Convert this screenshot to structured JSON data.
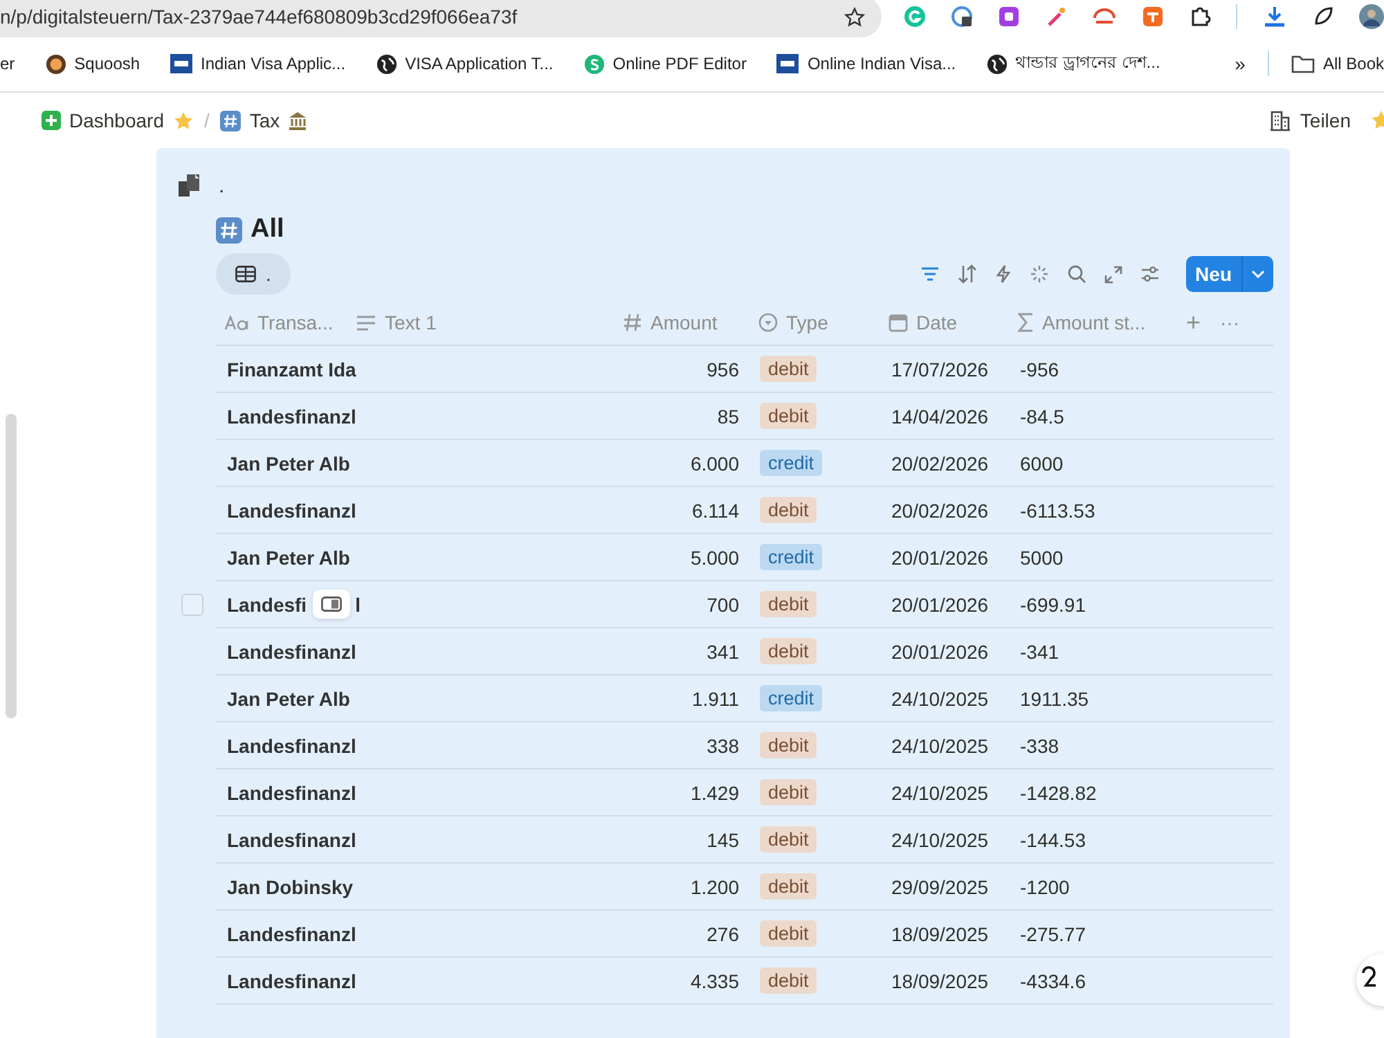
{
  "browser": {
    "url": "n/p/digitalsteuern/Tax-2379ae744ef680809b3cd29f066ea73f",
    "bookmarks": [
      "er",
      "Squoosh",
      "Indian Visa Applic...",
      "VISA Application T...",
      "Online PDF Editor",
      "Online Indian Visa...",
      "থান্ডার ড্রাগনের দেশ..."
    ],
    "more": "»",
    "all_bookmarks": "All Book"
  },
  "breadcrumbs": [
    "Dashboard",
    "Tax"
  ],
  "separator": "/",
  "share": "Teilen",
  "page": {
    "title": ".",
    "view_title": "All",
    "view_tab": ".",
    "new_button": "Neu",
    "columns": [
      "Transa...",
      "Text 1",
      "Amount",
      "Type",
      "Date",
      "Amount st..."
    ],
    "add_column": "+",
    "more": "···",
    "rows": [
      {
        "title": "Finanzamt Ida",
        "amount": "956",
        "type": "debit",
        "date": "17/07/2026",
        "amount_st": "-956",
        "hovered": false
      },
      {
        "title": "Landesfinanzl",
        "amount": "85",
        "type": "debit",
        "date": "14/04/2026",
        "amount_st": "-84.5",
        "hovered": false
      },
      {
        "title": "Jan Peter Alb",
        "amount": "6.000",
        "type": "credit",
        "date": "20/02/2026",
        "amount_st": "6000",
        "hovered": false
      },
      {
        "title": "Landesfinanzl",
        "amount": "6.114",
        "type": "debit",
        "date": "20/02/2026",
        "amount_st": "-6113.53",
        "hovered": false
      },
      {
        "title": "Jan Peter Alb",
        "amount": "5.000",
        "type": "credit",
        "date": "20/01/2026",
        "amount_st": "5000",
        "hovered": false
      },
      {
        "title": "Landesfi",
        "title_end": "l",
        "amount": "700",
        "type": "debit",
        "date": "20/01/2026",
        "amount_st": "-699.91",
        "hovered": true,
        "checked": false
      },
      {
        "title": "Landesfinanzl",
        "amount": "341",
        "type": "debit",
        "date": "20/01/2026",
        "amount_st": "-341",
        "hovered": false
      },
      {
        "title": "Jan Peter Alb",
        "amount": "1.911",
        "type": "credit",
        "date": "24/10/2025",
        "amount_st": "1911.35",
        "hovered": false
      },
      {
        "title": "Landesfinanzl",
        "amount": "338",
        "type": "debit",
        "date": "24/10/2025",
        "amount_st": "-338",
        "hovered": false
      },
      {
        "title": "Landesfinanzl",
        "amount": "1.429",
        "type": "debit",
        "date": "24/10/2025",
        "amount_st": "-1428.82",
        "hovered": false
      },
      {
        "title": "Landesfinanzl",
        "amount": "145",
        "type": "debit",
        "date": "24/10/2025",
        "amount_st": "-144.53",
        "hovered": false
      },
      {
        "title": "Jan Dobinsky",
        "amount": "1.200",
        "type": "debit",
        "date": "29/09/2025",
        "amount_st": "-1200",
        "hovered": false
      },
      {
        "title": "Landesfinanzl",
        "amount": "276",
        "type": "debit",
        "date": "18/09/2025",
        "amount_st": "-275.77",
        "hovered": false
      },
      {
        "title": "Landesfinanzl",
        "amount": "4.335",
        "type": "debit",
        "date": "18/09/2025",
        "amount_st": "-4334.6",
        "hovered": false
      }
    ]
  }
}
